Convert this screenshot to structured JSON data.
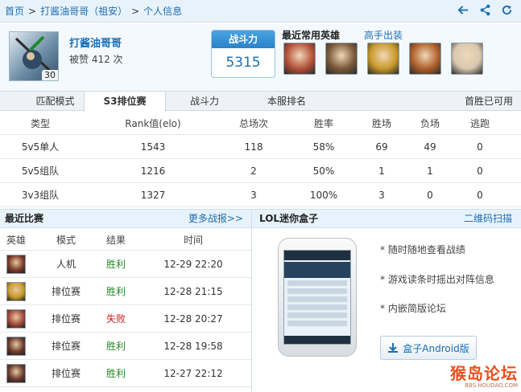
{
  "breadcrumb": {
    "home": "首页",
    "player": "打酱油哥哥（祖安）",
    "page": "个人信息"
  },
  "profile": {
    "name": "打酱油哥哥",
    "likes": "被赞 412 次",
    "level": "30"
  },
  "power": {
    "title": "战斗力",
    "value": "5315"
  },
  "favorites": {
    "title": "最近常用英雄",
    "expert_link": "高手出装",
    "heroes": [
      {
        "color": "#b5523a"
      },
      {
        "color": "#7a5a3a"
      },
      {
        "color": "#c99a2a"
      },
      {
        "color": "#b0602a"
      },
      {
        "color": "#d9c8b0"
      }
    ]
  },
  "tabs": [
    {
      "label": "匹配模式"
    },
    {
      "label": "S3排位赛"
    },
    {
      "label": "战斗力"
    },
    {
      "label": "本服排名"
    }
  ],
  "tab_right": "首胜已可用",
  "ranked": {
    "headers": [
      "类型",
      "Rank值(elo)",
      "总场次",
      "胜率",
      "胜场",
      "负场",
      "逃跑"
    ],
    "rows": [
      [
        "5v5单人",
        "1543",
        "118",
        "58%",
        "69",
        "49",
        "0"
      ],
      [
        "5v5组队",
        "1216",
        "2",
        "50%",
        "1",
        "1",
        "0"
      ],
      [
        "3v3组队",
        "1327",
        "3",
        "100%",
        "3",
        "0",
        "0"
      ]
    ]
  },
  "recent": {
    "title": "最近比赛",
    "more": "更多战报>>",
    "headers": [
      "英雄",
      "模式",
      "结果",
      "时间"
    ],
    "rows": [
      {
        "mode": "人机",
        "result": "胜利",
        "time": "12-29 22:20",
        "hero_color": "#7a3a2a"
      },
      {
        "mode": "排位赛",
        "result": "胜利",
        "time": "12-28 21:15",
        "hero_color": "#c99a2a"
      },
      {
        "mode": "排位赛",
        "result": "失败",
        "time": "12-28 20:27",
        "hero_color": "#a04a3a"
      },
      {
        "mode": "排位赛",
        "result": "胜利",
        "time": "12-28 19:58",
        "hero_color": "#6a3a2a"
      },
      {
        "mode": "排位赛",
        "result": "胜利",
        "time": "12-27 22:12",
        "hero_color": "#6a3a2a"
      }
    ]
  },
  "box": {
    "title": "LOL迷你盒子",
    "qr_link": "二维码扫描",
    "features": [
      "* 随时随地查看战绩",
      "* 游戏读条时摇出对阵信息",
      "* 内嵌简版论坛"
    ],
    "android_button": "盒子Android版"
  },
  "watermark": {
    "main": "猴岛论坛",
    "sub": "BBS.HOUDAO.COM"
  },
  "colors": {
    "link": "#1a6fb3",
    "win": "#2a8a2a",
    "lose": "#d02020",
    "header_bg": "#e8f2fa"
  }
}
